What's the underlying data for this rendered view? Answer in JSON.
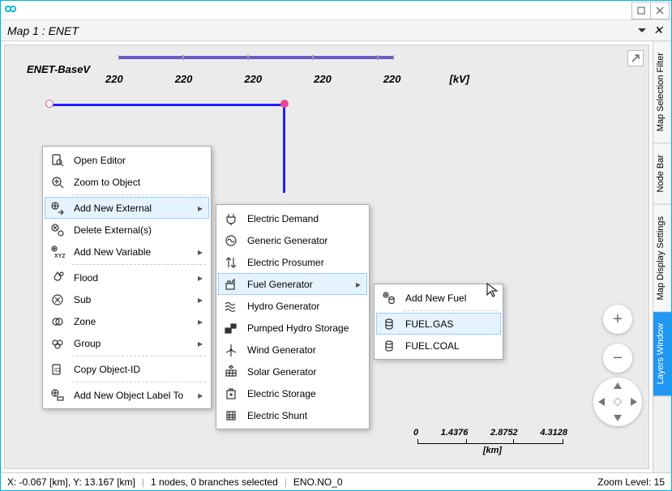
{
  "window": {
    "title": "Map 1 : ENET"
  },
  "voltage": {
    "label": "ENET-BaseV",
    "values": [
      "220",
      "220",
      "220",
      "220",
      "220"
    ],
    "unit": "[kV]"
  },
  "menu1": {
    "open_editor": "Open Editor",
    "zoom_to_object": "Zoom to Object",
    "add_new_external": "Add New External",
    "delete_externals": "Delete External(s)",
    "add_new_variable": "Add New Variable",
    "flood": "Flood",
    "sub": "Sub",
    "zone": "Zone",
    "group": "Group",
    "copy_object_id": "Copy Object-ID",
    "add_new_object_label_to": "Add New Object Label To"
  },
  "menu2": {
    "electric_demand": "Electric Demand",
    "generic_generator": "Generic Generator",
    "electric_prosumer": "Electric Prosumer",
    "fuel_generator": "Fuel Generator",
    "hydro_generator": "Hydro Generator",
    "pumped_hydro_storage": "Pumped Hydro Storage",
    "wind_generator": "Wind Generator",
    "solar_generator": "Solar Generator",
    "electric_storage": "Electric Storage",
    "electric_shunt": "Electric Shunt"
  },
  "menu3": {
    "add_new_fuel": "Add New Fuel",
    "fuel_gas": "FUEL.GAS",
    "fuel_coal": "FUEL.COAL"
  },
  "sidetabs": {
    "map_selection_filter": "Map Selection Filter",
    "node_bar": "Node Bar",
    "map_display_settings": "Map Display Settings",
    "layers_window": "Layers Window"
  },
  "scale": {
    "values": [
      "0",
      "1.4376",
      "2.8752",
      "4.3128"
    ],
    "unit": "[km]"
  },
  "status": {
    "coords": "X: -0.067 [km], Y: 13.167 [km]",
    "selection": "1 nodes, 0 branches selected",
    "object": "ENO.NO_0",
    "zoom": "Zoom Level: 15"
  },
  "zoom": {
    "plus": "+",
    "minus": "−"
  }
}
